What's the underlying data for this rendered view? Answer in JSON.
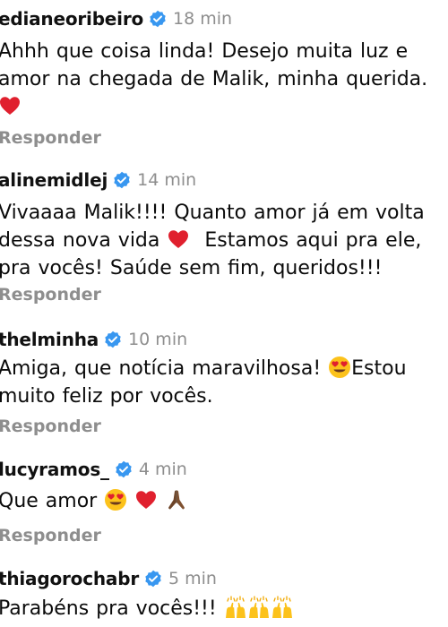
{
  "comments": [
    {
      "username": "edianeoribeiro",
      "time": "18 min",
      "lines": [
        "Ahhh que coisa linda! Desejo muita luz e",
        "amor na chegada de Malik, minha querida."
      ],
      "reply_label": "Responder"
    },
    {
      "username": "alinemidlej",
      "time": "14 min",
      "lines": [
        "Vivaaaa Malik!!!! Quanto amor já em volta",
        "dessa nova vida",
        "Estamos aqui pra ele,",
        "pra vocês! Saúde sem fim, queridos!!!"
      ],
      "reply_label": "Responder"
    },
    {
      "username": "thelminha",
      "time": "10 min",
      "lines": [
        "Amiga, que notícia maravilhosa!",
        "Estou",
        "muito feliz por vocês."
      ],
      "reply_label": "Responder"
    },
    {
      "username": "lucyramos_",
      "time": "4 min",
      "lines": [
        "Que amor"
      ],
      "reply_label": "Responder"
    },
    {
      "username": "thiagorochabr",
      "time": "5 min",
      "lines": [
        "Parabéns pra vocês!!!"
      ],
      "reply_label": ""
    }
  ],
  "colors": {
    "verified_badge": "#3897f0",
    "secondary_text": "#8e8e8e",
    "heart": "#e0202e"
  }
}
